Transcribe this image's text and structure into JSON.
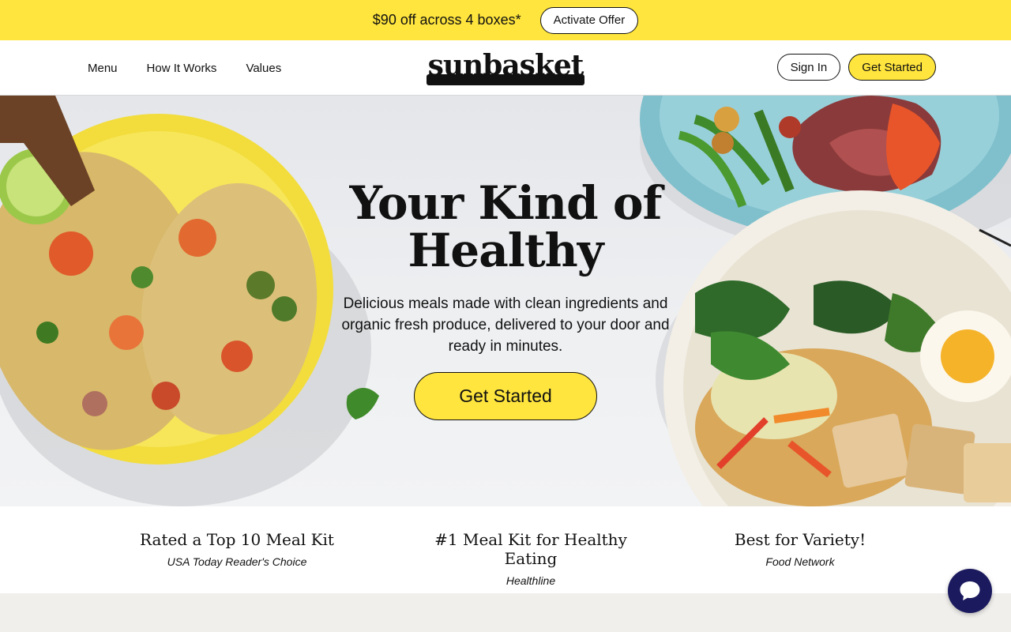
{
  "promo": {
    "text": "$90 off across 4 boxes*",
    "button": "Activate Offer"
  },
  "nav": {
    "items": [
      "Menu",
      "How It Works",
      "Values"
    ]
  },
  "logo": {
    "text": "sunbasket"
  },
  "header_actions": {
    "sign_in": "Sign In",
    "get_started": "Get Started"
  },
  "hero": {
    "title_line1": "Your Kind of",
    "title_line2": "Healthy",
    "subtitle": "Delicious meals made with clean ingredients and organic fresh produce, delivered to your door and ready in minutes.",
    "cta": "Get Started"
  },
  "accolades": [
    {
      "title": "Rated a Top 10 Meal Kit",
      "source": "USA Today Reader's Choice"
    },
    {
      "title": "#1 Meal Kit for Healthy Eating",
      "source": "Healthline"
    },
    {
      "title": "Best for Variety!",
      "source": "Food Network"
    }
  ],
  "chat": {
    "icon": "chat-bubble-icon"
  },
  "colors": {
    "brand_yellow": "#ffe53d",
    "chat_navy": "#1b1a5e"
  }
}
